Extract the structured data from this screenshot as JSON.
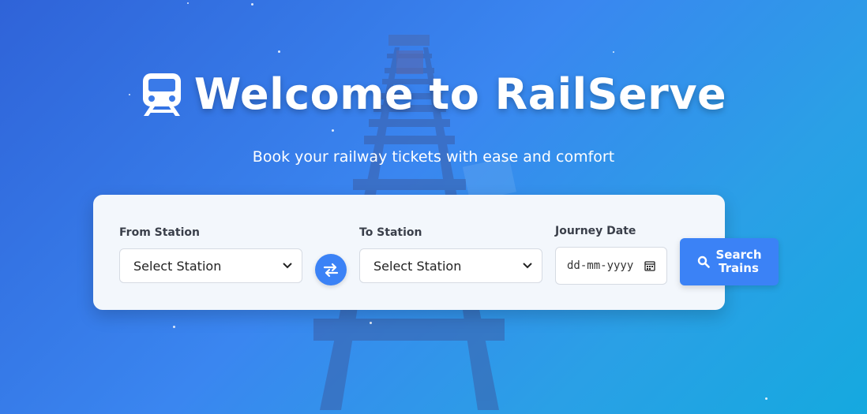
{
  "hero": {
    "title": "Welcome to RailServe",
    "subtitle": "Book your railway tickets with ease and comfort"
  },
  "search_form": {
    "from_label": "From Station",
    "from_value": "Select Station",
    "to_label": "To Station",
    "to_value": "Select Station",
    "date_label": "Journey Date",
    "date_placeholder": "dd-mm-yyyy",
    "search_button_label": "Search Trains"
  },
  "icons": {
    "brand": "train-icon",
    "swap": "swap-arrows-icon",
    "calendar": "calendar-icon",
    "search": "search-icon"
  },
  "colors": {
    "accent": "#3b82f6",
    "card": "#f3f7fc"
  }
}
